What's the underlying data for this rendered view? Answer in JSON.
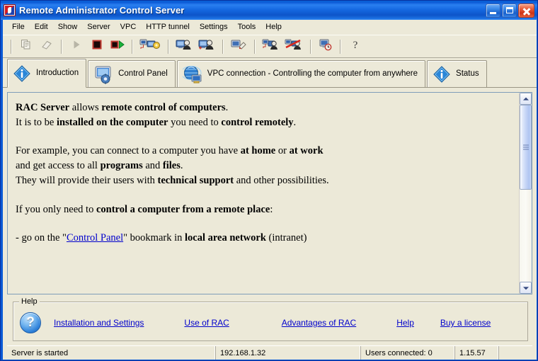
{
  "window": {
    "title": "Remote Administrator Control Server",
    "app_icon": "rac-logo-icon",
    "buttons": {
      "minimize": "Minimize",
      "maximize": "Maximize",
      "close": "Close"
    }
  },
  "menubar": {
    "items": [
      {
        "label": "File"
      },
      {
        "label": "Edit"
      },
      {
        "label": "Show"
      },
      {
        "label": "Server"
      },
      {
        "label": "VPC"
      },
      {
        "label": "HTTP tunnel"
      },
      {
        "label": "Settings"
      },
      {
        "label": "Tools"
      },
      {
        "label": "Help"
      }
    ]
  },
  "toolbar": {
    "buttons": [
      {
        "name": "copy-icon",
        "title": "Copy",
        "enabled": false
      },
      {
        "name": "eraser-icon",
        "title": "Erase",
        "enabled": false
      },
      {
        "name": "play-icon",
        "title": "Start",
        "enabled": false
      },
      {
        "name": "stop-icon",
        "title": "Stop",
        "enabled": true
      },
      {
        "name": "stop-and-start-icon",
        "title": "Restart",
        "enabled": true
      },
      {
        "name": "network-settings-icon",
        "title": "Network settings",
        "enabled": true
      },
      {
        "name": "user-icon",
        "title": "User",
        "enabled": true
      },
      {
        "name": "user-add-icon",
        "title": "Add user",
        "enabled": true
      },
      {
        "name": "user-properties-icon",
        "title": "User properties",
        "enabled": true
      },
      {
        "name": "connect-user-icon",
        "title": "Connect user",
        "enabled": true
      },
      {
        "name": "disconnect-user-icon",
        "title": "Disconnect user",
        "enabled": true
      },
      {
        "name": "server-clock-icon",
        "title": "Server log",
        "enabled": true
      },
      {
        "name": "help-question-icon",
        "title": "Help",
        "enabled": true
      }
    ]
  },
  "tabs": [
    {
      "label": "Introduction",
      "icon": "info-diamond-icon",
      "selected": true
    },
    {
      "label": "Control Panel",
      "icon": "monitor-gear-icon",
      "selected": false
    },
    {
      "label": "VPC connection - Controlling the computer from anywhere",
      "icon": "globe-monitor-icon",
      "selected": false
    },
    {
      "label": "Status",
      "icon": "info-diamond-icon",
      "selected": false
    }
  ],
  "content": {
    "paragraphs": [
      {
        "lines": [
          [
            {
              "t": "RAC Server",
              "b": true
            },
            {
              "t": " allows "
            },
            {
              "t": "remote control of computers",
              "b": true
            },
            {
              "t": "."
            }
          ],
          [
            {
              "t": "It is to be "
            },
            {
              "t": "installed on the computer",
              "b": true
            },
            {
              "t": " you need to "
            },
            {
              "t": "control remotely",
              "b": true
            },
            {
              "t": "."
            }
          ]
        ]
      },
      {
        "lines": [
          [
            {
              "t": "For example, you can connect to a computer you have "
            },
            {
              "t": "at home",
              "b": true
            },
            {
              "t": " or "
            },
            {
              "t": "at work",
              "b": true
            }
          ],
          [
            {
              "t": "and get access to all "
            },
            {
              "t": "programs",
              "b": true
            },
            {
              "t": " and "
            },
            {
              "t": "files",
              "b": true
            },
            {
              "t": "."
            }
          ],
          [
            {
              "t": "They will provide their users with "
            },
            {
              "t": "technical support",
              "b": true
            },
            {
              "t": " and other possibilities."
            }
          ]
        ]
      },
      {
        "lines": [
          [
            {
              "t": "If you only need to "
            },
            {
              "t": "control a computer from a remote place",
              "b": true
            },
            {
              "t": ":"
            }
          ]
        ]
      },
      {
        "lines": [
          [
            {
              "t": "- go on the \""
            },
            {
              "t": "Control Panel",
              "link": true
            },
            {
              "t": "\" bookmark in "
            },
            {
              "t": "local area network",
              "b": true
            },
            {
              "t": " (intranet)"
            }
          ]
        ]
      }
    ],
    "scrollbar": {
      "up_arrow": "scroll-up-icon",
      "down_arrow": "scroll-down-icon",
      "thumb_position_percent": 0,
      "thumb_size_percent": 48
    }
  },
  "help_panel": {
    "legend": "Help",
    "icon": "help-question-icon",
    "links": [
      {
        "label": "Installation and Settings"
      },
      {
        "label": "Use of RAC"
      },
      {
        "label": "Advantages of RAC"
      },
      {
        "label": "Help"
      },
      {
        "label": "Buy a license"
      }
    ]
  },
  "statusbar": {
    "server_status": "Server is started",
    "ip_address": "192.168.1.32",
    "users_connected": "Users connected: 0",
    "version": "1.15.57",
    "extra": ""
  }
}
